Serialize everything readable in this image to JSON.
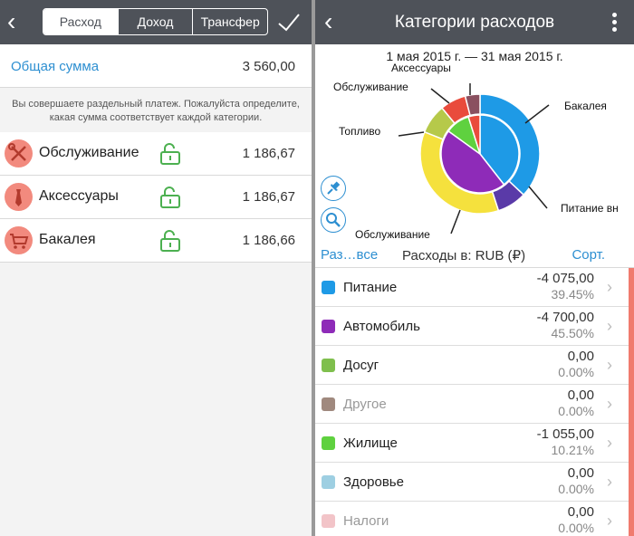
{
  "left": {
    "tabs": [
      "Расход",
      "Доход",
      "Трансфер"
    ],
    "active_tab": 0,
    "total_label": "Общая сумма",
    "total_value": "3 560,00",
    "note": "Вы совершаете раздельный платеж. Пожалуйста определите, какая сумма соответствует каждой категории.",
    "categories": [
      {
        "name": "Обслуживание",
        "amount": "1 186,67",
        "icon": "wrench-screwdriver-icon"
      },
      {
        "name": "Аксессуары",
        "amount": "1 186,67",
        "icon": "tie-icon"
      },
      {
        "name": "Бакалея",
        "amount": "1 186,66",
        "icon": "shopping-cart-icon"
      }
    ]
  },
  "right": {
    "title": "Категории расходов",
    "date_range": "1 мая 2015 г. — 31 мая 2015 г.",
    "toolbar": {
      "expand": "Раз…все",
      "currency": "Расходы в: RUB (₽)",
      "sort": "Сорт."
    },
    "pie_labels": {
      "accessories": "Аксессуары",
      "service_top": "Обслуживание",
      "fuel": "Топливо",
      "grocery": "Бакалея",
      "food": "Питание вн",
      "service_bottom": "Обслуживание"
    },
    "list": [
      {
        "name": "Питание",
        "amount": "-4 075,00",
        "pct": "39.45%",
        "color": "#1e9ae6"
      },
      {
        "name": "Автомобиль",
        "amount": "-4 700,00",
        "pct": "45.50%",
        "color": "#8e2bb8"
      },
      {
        "name": "Досуг",
        "amount": "0,00",
        "pct": "0.00%",
        "color": "#7fbf4d"
      },
      {
        "name": "Другое",
        "amount": "0,00",
        "pct": "0.00%",
        "color": "#a0897e",
        "dim": true
      },
      {
        "name": "Жилище",
        "amount": "-1 055,00",
        "pct": "10.21%",
        "color": "#5fd13f"
      },
      {
        "name": "Здоровье",
        "amount": "0,00",
        "pct": "0.00%",
        "color": "#9ecfe2"
      },
      {
        "name": "Налоги",
        "amount": "0,00",
        "pct": "0.00%",
        "color": "#f2c4c8",
        "dim": true
      }
    ]
  },
  "chart_data": {
    "type": "pie",
    "inner": [
      {
        "name": "Питание",
        "value": 39.45,
        "color": "#1e9ae6"
      },
      {
        "name": "Автомобиль",
        "value": 45.5,
        "color": "#8e2bb8"
      },
      {
        "name": "Жилище",
        "value": 10.21,
        "color": "#5fd13f"
      },
      {
        "name": "Другое",
        "value": 4.84,
        "color": "#e94b3c"
      }
    ],
    "outer": [
      {
        "name": "Бакалея",
        "value": 37,
        "color": "#1e9ae6"
      },
      {
        "name": "Питание вн",
        "value": 8,
        "color": "#5a3aa8"
      },
      {
        "name": "Обслуживание",
        "value": 36,
        "color": "#f5e13d"
      },
      {
        "name": "Топливо",
        "value": 8,
        "color": "#b6c94a"
      },
      {
        "name": "Обслуживание",
        "value": 7,
        "color": "#e94b3c"
      },
      {
        "name": "Аксессуары",
        "value": 4,
        "color": "#8a5060"
      }
    ]
  }
}
